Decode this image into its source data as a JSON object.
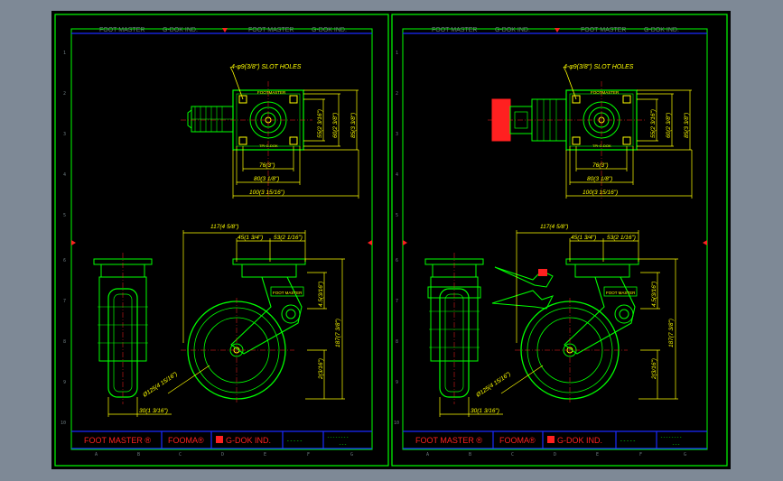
{
  "colors": {
    "background": "#7e8996",
    "canvas": "#000000",
    "frame": "#00ff00",
    "blue": "#1a2bff",
    "yellow": "#ffff00",
    "drawing": "#00ff00",
    "red": "#ff2020",
    "muted": "#6b7b7f"
  },
  "sheets": [
    {
      "id": "left",
      "header": {
        "col1": "FOOT MASTER",
        "col2": "G-DOK IND.",
        "col3": "FOOT MASTER",
        "col4": "G-DOK IND."
      },
      "top_view": {
        "slot_note": "4-φ9(3/8\") SLOT HOLES",
        "plate_text_top": "FOOTMASTER",
        "plate_text_bottom": "TPI·G-DOK",
        "dim_76": "76(3\")",
        "dim_80": "80(3 1/8\")",
        "dim_100": "100(3 15/16\")",
        "dim_55": "55(2 3/16\")",
        "dim_60": "60(2 3/8\")",
        "dim_85": "85(3 3/8\")"
      },
      "side_view": {
        "dim_117": "117(4 5/8\")",
        "dim_45": "45(1 3/4\")",
        "dim_53": "53(2 1/16\")",
        "dim_45v": "4.5(3/16\")",
        "dim_187": "187(7 3/8\")",
        "dim_2": "2(3/16\")",
        "dim_dia": "Ø125(4 15/16\")",
        "dim_30": "30(1 3/16\")",
        "label": "FOOT MASTER"
      },
      "title_block": {
        "brand1": "FOOT MASTER ®",
        "brand2": "FOOMA®",
        "brand3": "G-DOK IND.",
        "code1": "-----",
        "code2": "--------",
        "code3": "---"
      },
      "zone_letters": [
        "A",
        "B",
        "C",
        "D",
        "E",
        "F",
        "G"
      ],
      "zone_numbers": [
        "1",
        "2",
        "3",
        "4",
        "5",
        "6",
        "7",
        "8",
        "9",
        "10"
      ]
    },
    {
      "id": "right",
      "header": {
        "col1": "FOOT MASTER",
        "col2": "G-DOK IND.",
        "col3": "FOOT MASTER",
        "col4": "G-DOK IND."
      },
      "top_view": {
        "slot_note": "4-φ9(3/8\") SLOT HOLES",
        "plate_text_top": "FOOTMASTER",
        "plate_text_bottom": "TPI·G-DOK",
        "dim_76": "76(3\")",
        "dim_80": "80(3 1/8\")",
        "dim_100": "100(3 15/16\")",
        "dim_55": "55(2 3/16\")",
        "dim_60": "60(2 3/8\")",
        "dim_85": "85(3 3/8\")"
      },
      "side_view": {
        "dim_117": "117(4 5/8\")",
        "dim_45": "45(1 3/4\")",
        "dim_53": "53(2 1/16\")",
        "dim_45v": "4.5(3/16\")",
        "dim_187": "187(7 3/8\")",
        "dim_2": "2(3/16\")",
        "dim_dia": "Ø125(4 15/16\")",
        "dim_30": "30(1 3/16\")",
        "label": "FOOT MASTER"
      },
      "title_block": {
        "brand1": "FOOT MASTER ®",
        "brand2": "FOOMA®",
        "brand3": "G-DOK IND.",
        "code1": "-----",
        "code2": "--------",
        "code3": "---"
      },
      "zone_letters": [
        "A",
        "B",
        "C",
        "D",
        "E",
        "F",
        "G"
      ],
      "zone_numbers": [
        "1",
        "2",
        "3",
        "4",
        "5",
        "6",
        "7",
        "8",
        "9",
        "10"
      ]
    }
  ]
}
